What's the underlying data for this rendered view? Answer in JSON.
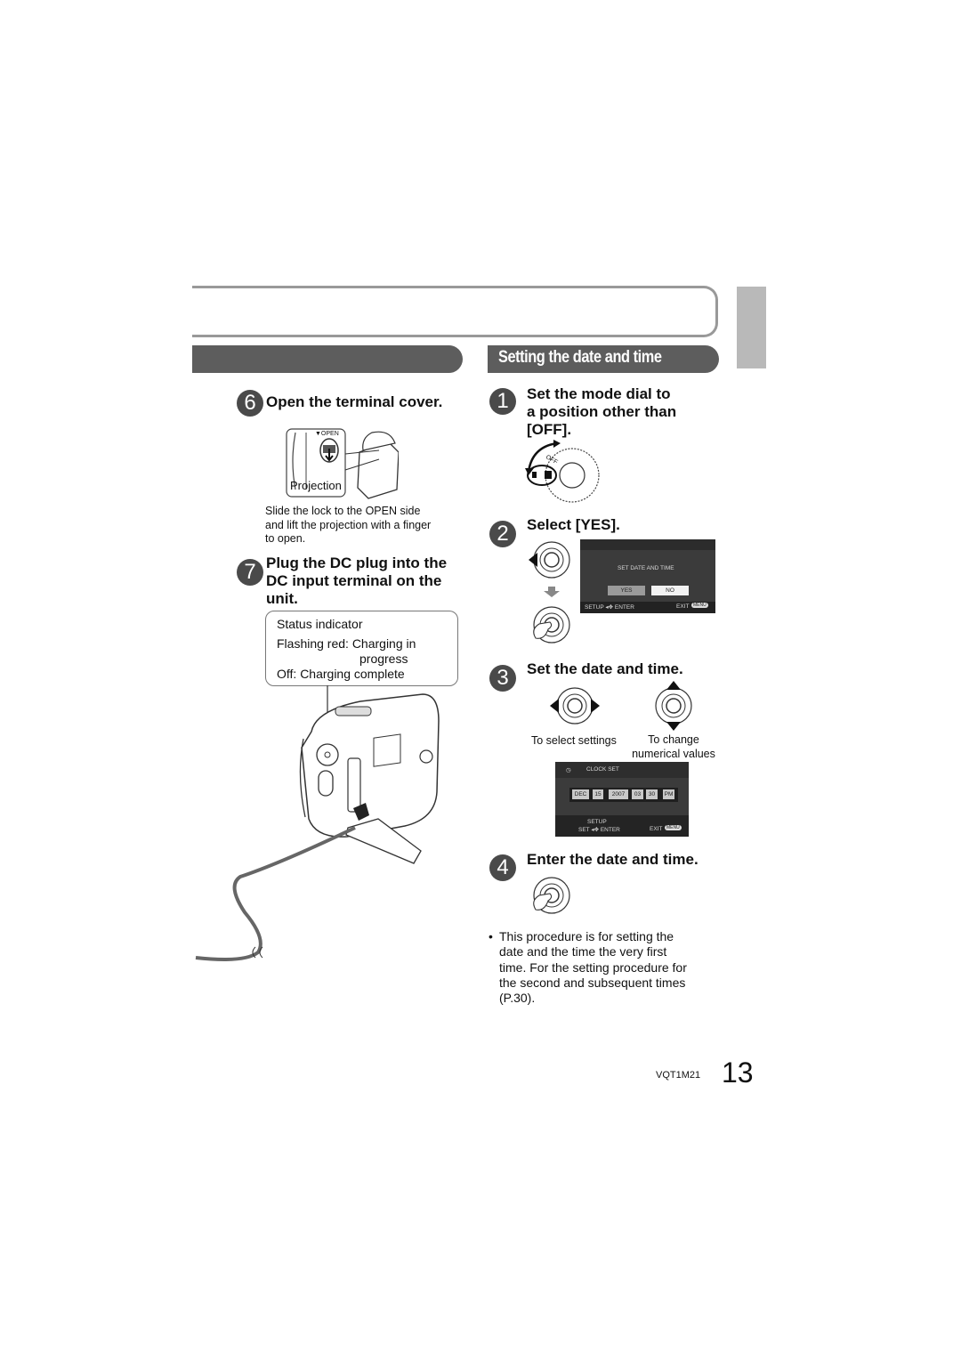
{
  "header": {
    "section_title": "Setting the date and time",
    "left_section_title": ""
  },
  "left": {
    "step6": {
      "number": "6",
      "title": "Open the terminal cover.",
      "figure_labels": {
        "open": "▼OPEN",
        "projection": "Projection"
      },
      "caption": [
        "Slide the lock to the OPEN side",
        "and lift the projection with a finger",
        "to open."
      ]
    },
    "step7": {
      "number": "7",
      "title": [
        "Plug the DC plug into the",
        "DC input terminal on the",
        "unit."
      ],
      "status_box": {
        "heading": "Status indicator",
        "line1": "Flashing red: Charging in",
        "line1b": "progress",
        "line2": "Off: Charging complete"
      }
    }
  },
  "right": {
    "step1": {
      "number": "1",
      "title": [
        "Set the mode dial to",
        "a position other than",
        "[OFF]."
      ],
      "dial_label": "OFF"
    },
    "step2": {
      "number": "2",
      "title": "Select [YES].",
      "screen": {
        "heading": "SET DATE AND TIME",
        "yes": "YES",
        "no": "NO",
        "footer_left": "SETUP ◂✥ ENTER",
        "footer_right": "EXIT",
        "menu_badge": "MENU"
      }
    },
    "step3": {
      "number": "3",
      "title": "Set the date and time.",
      "label_select": "To select settings",
      "label_change": [
        "To change",
        "numerical values"
      ],
      "screen": {
        "heading": "CLOCK SET",
        "month": "DEC",
        "day": "15",
        "year": "2007",
        "hour": "03",
        "minute": "30",
        "ampm": "PM",
        "footer_top": "SETUP",
        "footer_left": "SET ◂✥ ENTER",
        "footer_right": "EXIT",
        "menu_badge": "MENU"
      }
    },
    "step4": {
      "number": "4",
      "title": "Enter the date and time."
    },
    "note": {
      "bullet": "•",
      "lines": [
        "This procedure is for setting the",
        "date and the time the very first",
        "time. For the setting procedure for",
        "the second and subsequent times",
        "(P.30)."
      ]
    }
  },
  "footer": {
    "doc_code": "VQT1M21",
    "page_number": "13"
  }
}
